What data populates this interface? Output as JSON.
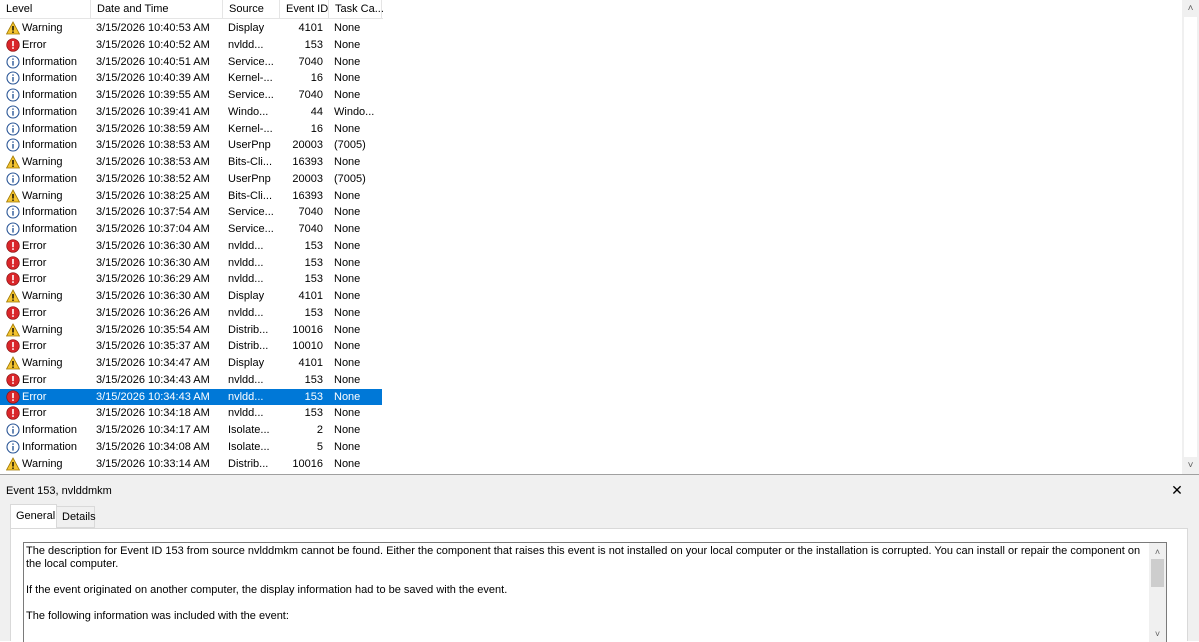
{
  "columns": {
    "level": "Level",
    "date_time": "Date and Time",
    "source": "Source",
    "event_id": "Event ID",
    "task_category": "Task Ca..."
  },
  "level_icons": {
    "Warning": "warning-icon",
    "Error": "error-icon",
    "Information": "information-icon"
  },
  "colors": {
    "selection": "#0078d7",
    "warning": "#f4c430",
    "error": "#d9262a",
    "information": "#2b5797"
  },
  "events": [
    {
      "level": "Warning",
      "date": "3/15/2026 10:40:53 AM",
      "source": "Display",
      "event_id": "4101",
      "task": "None"
    },
    {
      "level": "Error",
      "date": "3/15/2026 10:40:52 AM",
      "source": "nvldd...",
      "event_id": "153",
      "task": "None"
    },
    {
      "level": "Information",
      "date": "3/15/2026 10:40:51 AM",
      "source": "Service...",
      "event_id": "7040",
      "task": "None"
    },
    {
      "level": "Information",
      "date": "3/15/2026 10:40:39 AM",
      "source": "Kernel-...",
      "event_id": "16",
      "task": "None"
    },
    {
      "level": "Information",
      "date": "3/15/2026 10:39:55 AM",
      "source": "Service...",
      "event_id": "7040",
      "task": "None"
    },
    {
      "level": "Information",
      "date": "3/15/2026 10:39:41 AM",
      "source": "Windo...",
      "event_id": "44",
      "task": "Windo..."
    },
    {
      "level": "Information",
      "date": "3/15/2026 10:38:59 AM",
      "source": "Kernel-...",
      "event_id": "16",
      "task": "None"
    },
    {
      "level": "Information",
      "date": "3/15/2026 10:38:53 AM",
      "source": "UserPnp",
      "event_id": "20003",
      "task": "(7005)"
    },
    {
      "level": "Warning",
      "date": "3/15/2026 10:38:53 AM",
      "source": "Bits-Cli...",
      "event_id": "16393",
      "task": "None"
    },
    {
      "level": "Information",
      "date": "3/15/2026 10:38:52 AM",
      "source": "UserPnp",
      "event_id": "20003",
      "task": "(7005)"
    },
    {
      "level": "Warning",
      "date": "3/15/2026 10:38:25 AM",
      "source": "Bits-Cli...",
      "event_id": "16393",
      "task": "None"
    },
    {
      "level": "Information",
      "date": "3/15/2026 10:37:54 AM",
      "source": "Service...",
      "event_id": "7040",
      "task": "None"
    },
    {
      "level": "Information",
      "date": "3/15/2026 10:37:04 AM",
      "source": "Service...",
      "event_id": "7040",
      "task": "None"
    },
    {
      "level": "Error",
      "date": "3/15/2026 10:36:30 AM",
      "source": "nvldd...",
      "event_id": "153",
      "task": "None"
    },
    {
      "level": "Error",
      "date": "3/15/2026 10:36:30 AM",
      "source": "nvldd...",
      "event_id": "153",
      "task": "None"
    },
    {
      "level": "Error",
      "date": "3/15/2026 10:36:29 AM",
      "source": "nvldd...",
      "event_id": "153",
      "task": "None"
    },
    {
      "level": "Warning",
      "date": "3/15/2026 10:36:30 AM",
      "source": "Display",
      "event_id": "4101",
      "task": "None"
    },
    {
      "level": "Error",
      "date": "3/15/2026 10:36:26 AM",
      "source": "nvldd...",
      "event_id": "153",
      "task": "None"
    },
    {
      "level": "Warning",
      "date": "3/15/2026 10:35:54 AM",
      "source": "Distrib...",
      "event_id": "10016",
      "task": "None"
    },
    {
      "level": "Error",
      "date": "3/15/2026 10:35:37 AM",
      "source": "Distrib...",
      "event_id": "10010",
      "task": "None"
    },
    {
      "level": "Warning",
      "date": "3/15/2026 10:34:47 AM",
      "source": "Display",
      "event_id": "4101",
      "task": "None"
    },
    {
      "level": "Error",
      "date": "3/15/2026 10:34:43 AM",
      "source": "nvldd...",
      "event_id": "153",
      "task": "None"
    },
    {
      "level": "Error",
      "date": "3/15/2026 10:34:43 AM",
      "source": "nvldd...",
      "event_id": "153",
      "task": "None",
      "selected": true
    },
    {
      "level": "Error",
      "date": "3/15/2026 10:34:18 AM",
      "source": "nvldd...",
      "event_id": "153",
      "task": "None"
    },
    {
      "level": "Information",
      "date": "3/15/2026 10:34:17 AM",
      "source": "Isolate...",
      "event_id": "2",
      "task": "None"
    },
    {
      "level": "Information",
      "date": "3/15/2026 10:34:08 AM",
      "source": "Isolate...",
      "event_id": "5",
      "task": "None"
    },
    {
      "level": "Warning",
      "date": "3/15/2026 10:33:14 AM",
      "source": "Distrib...",
      "event_id": "10016",
      "task": "None"
    }
  ],
  "detail": {
    "title": "Event 153, nvlddmkm",
    "close_label": "✕",
    "tabs": [
      "General",
      "Details"
    ],
    "active_tab": "General",
    "description": [
      "The description for Event ID 153 from source nvlddmkm cannot be found. Either the component that raises this event is not installed on your local computer or the installation is corrupted. You can install or repair the component on the local computer.",
      "If the event originated on another computer, the display information had to be saved with the event.",
      "The following information was included with the event:"
    ]
  }
}
